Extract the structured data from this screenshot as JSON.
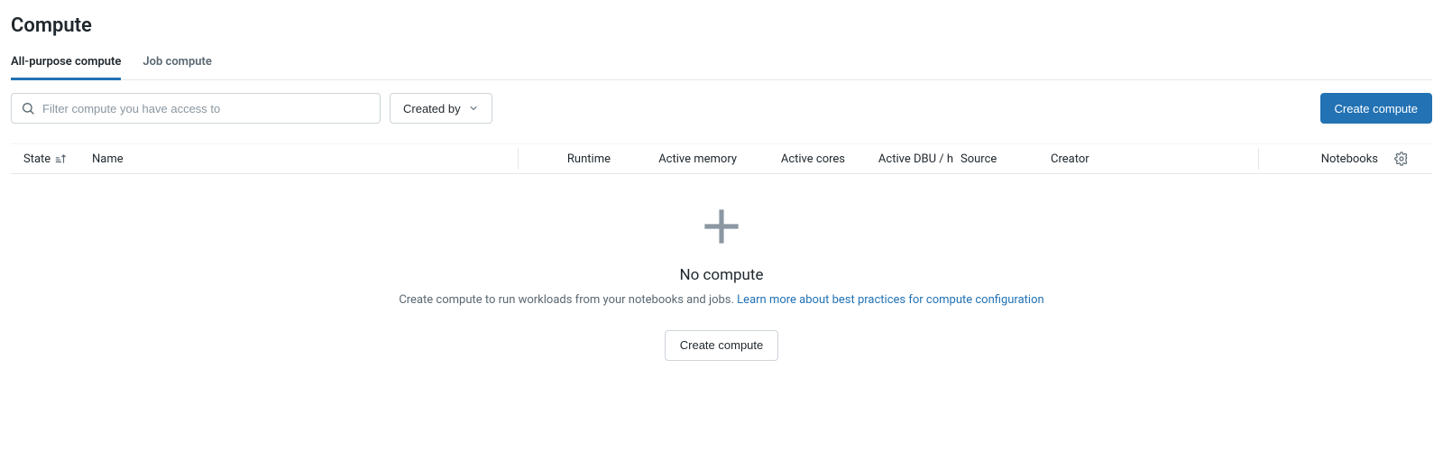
{
  "page": {
    "title": "Compute"
  },
  "tabs": {
    "all_purpose": "All-purpose compute",
    "job": "Job compute"
  },
  "toolbar": {
    "search_placeholder": "Filter compute you have access to",
    "filter_label": "Created by",
    "create_label": "Create compute"
  },
  "columns": {
    "state": "State",
    "name": "Name",
    "runtime": "Runtime",
    "active_memory": "Active memory",
    "active_cores": "Active cores",
    "active_dbu": "Active DBU / h",
    "source": "Source",
    "creator": "Creator",
    "notebooks": "Notebooks"
  },
  "empty": {
    "title": "No compute",
    "desc_prefix": "Create compute to run workloads from your notebooks and jobs. ",
    "link_text": "Learn more about best practices for compute configuration",
    "create_label": "Create compute"
  }
}
